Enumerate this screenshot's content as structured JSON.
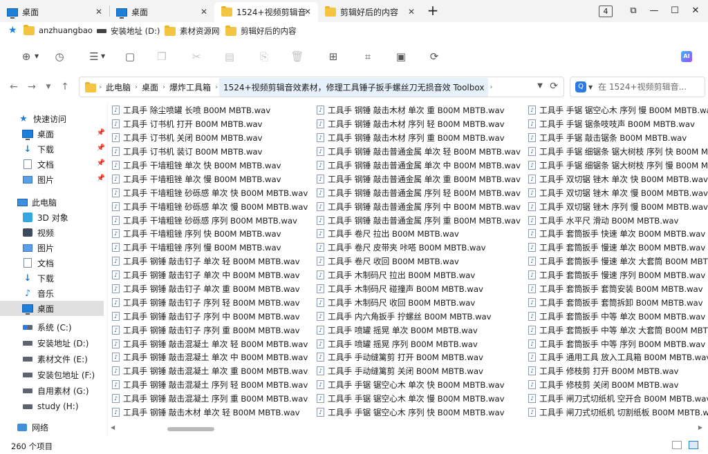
{
  "tabs": [
    {
      "label": "桌面",
      "icon": "monitor",
      "active": false
    },
    {
      "label": "桌面",
      "icon": "monitor",
      "active": false
    },
    {
      "label": "1524+视频剪辑音",
      "icon": "folder",
      "active": true
    },
    {
      "label": "剪辑好后的内容",
      "icon": "folder",
      "active": false
    }
  ],
  "tab_count": "4",
  "bookmarks": [
    {
      "label": "anzhuangbao",
      "icon": "folder"
    },
    {
      "label": "安装地址 (D:)",
      "icon": "drive"
    },
    {
      "label": "素材资源网",
      "icon": "folder"
    },
    {
      "label": "剪辑好后的内容",
      "icon": "folder"
    }
  ],
  "address": {
    "crumbs": [
      "此电脑",
      "桌面",
      "爆炸工具箱",
      "1524+视频剪辑音效素材，修理工具锤子扳手螺丝刀无损音效 Toolbox"
    ]
  },
  "search": {
    "placeholder": "在 1524+视频剪辑音..."
  },
  "nav": {
    "quick_access": "快速访问",
    "quick_items": [
      "桌面",
      "下载",
      "文档",
      "图片"
    ],
    "this_pc": "此电脑",
    "pc_items": [
      "3D 对象",
      "视频",
      "图片",
      "文档",
      "下载",
      "音乐",
      "桌面",
      "系统 (C:)",
      "安装地址 (D:)",
      "素材文件 (E:)",
      "安装包地址 (F:)",
      "自用素材 (G:)",
      "study (H:)"
    ],
    "network": "网络"
  },
  "files": {
    "col1": [
      "工具手 除尘喷罐 长喷 B00M MBTB.wav",
      "工具手 订书机 打开 B00M MBTB.wav",
      "工具手 订书机 关闭 B00M MBTB.wav",
      "工具手 订书机 装订 B00M MBTB.wav",
      "工具手 干墙粗锉 单次 快 B00M MBTB.wav",
      "工具手 干墙粗锉 单次 慢 B00M MBTB.wav",
      "工具手 干墙粗锉 砂砾感 单次 快 B00M MBTB.wav",
      "工具手 干墙粗锉 砂砾感 单次 慢 B00M MBTB.wav",
      "工具手 干墙粗锉 砂砾感 序列 B00M MBTB.wav",
      "工具手 干墙粗锉 序列 快 B00M MBTB.wav",
      "工具手 干墙粗锉 序列 慢 B00M MBTB.wav",
      "工具手 钢锤 敲击钉子 单次 轻 B00M MBTB.wav",
      "工具手 钢锤 敲击钉子 单次 中 B00M MBTB.wav",
      "工具手 钢锤 敲击钉子 单次 重 B00M MBTB.wav",
      "工具手 钢锤 敲击钉子 序列 轻 B00M MBTB.wav",
      "工具手 钢锤 敲击钉子 序列 中 B00M MBTB.wav",
      "工具手 钢锤 敲击钉子 序列 重 B00M MBTB.wav",
      "工具手 钢锤 敲击混凝土 单次 轻 B00M MBTB.wav",
      "工具手 钢锤 敲击混凝土 单次 中 B00M MBTB.wav",
      "工具手 钢锤 敲击混凝土 单次 重 B00M MBTB.wav",
      "工具手 钢锤 敲击混凝土 序列 轻 B00M MBTB.wav",
      "工具手 钢锤 敲击混凝土 序列 重 B00M MBTB.wav",
      "工具手 钢锤 敲击木材 单次 轻 B00M MBTB.wav"
    ],
    "col2": [
      "工具手 钢锤 敲击木材 单次 重 B00M MBTB.wav",
      "工具手 钢锤 敲击木材 序列 轻 B00M MBTB.wav",
      "工具手 钢锤 敲击木材 序列 重 B00M MBTB.wav",
      "工具手 钢锤 敲击普通金属 单次 轻 B00M MBTB.wav",
      "工具手 钢锤 敲击普通金属 单次 中 B00M MBTB.wav",
      "工具手 钢锤 敲击普通金属 单次 重 B00M MBTB.wav",
      "工具手 钢锤 敲击普通金属 序列 轻 B00M MBTB.wav",
      "工具手 钢锤 敲击普通金属 序列 中 B00M MBTB.wav",
      "工具手 钢锤 敲击普通金属 序列 重 B00M MBTB.wav",
      "工具手 卷尺 拉出 B00M MBTB.wav",
      "工具手 卷尺 皮带夹 咔嗒 B00M MBTB.wav",
      "工具手 卷尺 收回 B00M MBTB.wav",
      "工具手 木制码尺 拉出 B00M MBTB.wav",
      "工具手 木制码尺 碰撞声 B00M MBTB.wav",
      "工具手 木制码尺 收回 B00M MBTB.wav",
      "工具手 内六角扳手 拧螺丝 B00M MBTB.wav",
      "工具手 喷罐 摇晃 单次 B00M MBTB.wav",
      "工具手 喷罐 摇晃 序列 B00M MBTB.wav",
      "工具手 手动缝篱剪 打开 B00M MBTB.wav",
      "工具手 手动缝篱剪 关闭 B00M MBTB.wav",
      "工具手 手锯 锯空心木 单次 快 B00M MBTB.wav",
      "工具手 手锯 锯空心木 单次 慢 B00M MBTB.wav",
      "工具手 手锯 锯空心木 序列 快 B00M MBTB.wav"
    ],
    "col3": [
      "工具手 手锯 锯空心木 序列 慢 B00M MBTB.wav",
      "工具手 手锯 锯条吱吱声 B00M MBTB.wav",
      "工具手 手锯 敲击锯条 B00M MBTB.wav",
      "工具手 手锯 细锯条 锯大树枝 序列 快 B00M MBTB.wav",
      "工具手 手锯 细锯条 锯大树枝 序列 慢 B00M MBTB.wav",
      "工具手 双切锯 锉木 单次 快 B00M MBTB.wav",
      "工具手 双切锯 锉木 单次 慢 B00M MBTB.wav",
      "工具手 双切锯 锉木 序列 慢 B00M MBTB.wav",
      "工具手 水平尺 滑动 B00M MBTB.wav",
      "工具手 套筒扳手 快速 单次 B00M MBTB.wav",
      "工具手 套筒扳手 慢速 单次 B00M MBTB.wav",
      "工具手 套筒扳手 慢速 单次 大套筒 B00M MBTB.wav",
      "工具手 套筒扳手 慢速 序列 B00M MBTB.wav",
      "工具手 套筒扳手 套筒安装 B00M MBTB.wav",
      "工具手 套筒扳手 套筒拆卸 B00M MBTB.wav",
      "工具手 套筒扳手 中等 单次 B00M MBTB.wav",
      "工具手 套筒扳手 中等 单次 大套筒 B00M MBTB.wav",
      "工具手 套筒扳手 中等 序列 B00M MBTB.wav",
      "工具手 通用工具 放入工具箱 B00M MBTB.wav",
      "工具手 修枝剪 打开 B00M MBTB.wav",
      "工具手 修枝剪 关闭 B00M MBTB.wav",
      "工具手 闸刀式切纸机 空开合 B00M MBTB.wav",
      "工具手 闸刀式切纸机 切割纸板 B00M MBTB.wav"
    ]
  },
  "status": {
    "item_count": "260 个项目"
  }
}
